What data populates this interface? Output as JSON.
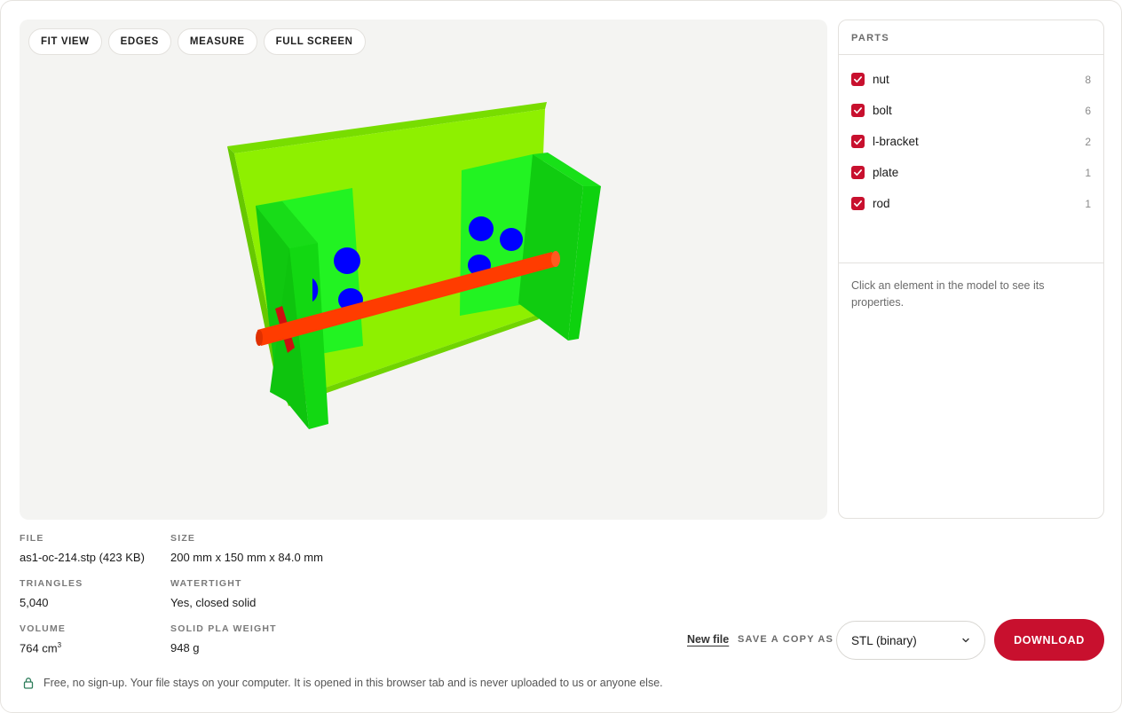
{
  "toolbar": {
    "fit_view": "FIT VIEW",
    "edges": "EDGES",
    "measure": "MEASURE",
    "full_screen": "FULL SCREEN"
  },
  "parts": {
    "title": "PARTS",
    "items": [
      {
        "name": "nut",
        "count": "8",
        "checked": true
      },
      {
        "name": "bolt",
        "count": "6",
        "checked": true
      },
      {
        "name": "l-bracket",
        "count": "2",
        "checked": true
      },
      {
        "name": "plate",
        "count": "1",
        "checked": true
      },
      {
        "name": "rod",
        "count": "1",
        "checked": true
      }
    ],
    "hint": "Click an element in the model to see its properties."
  },
  "info": {
    "file_label": "FILE",
    "file_value": "as1-oc-214.stp (423 KB)",
    "size_label": "SIZE",
    "size_value": "200 mm x 150 mm x 84.0 mm",
    "triangles_label": "TRIANGLES",
    "triangles_value": "5,040",
    "watertight_label": "WATERTIGHT",
    "watertight_value": "Yes, closed solid",
    "volume_label": "VOLUME",
    "volume_value": "764 cm",
    "volume_unit_sup": "3",
    "weight_label": "SOLID PLA WEIGHT",
    "weight_value": "948 g"
  },
  "actions": {
    "new_file": "New file",
    "save_copy_as": "SAVE A COPY AS",
    "format_selected": "STL (binary)",
    "download": "DOWNLOAD"
  },
  "footer": {
    "privacy_text": "Free, no sign-up. Your file stays on your computer. It is opened in this browser tab and is never uploaded to us or anyone else."
  },
  "icons": {
    "lock": "lock-icon",
    "chevron": "chevron-down-icon",
    "check": "check-icon"
  },
  "colors": {
    "accent": "#c8102e",
    "plate": "#8ef000",
    "bracket": "#00e81a",
    "nut": "#0000ff",
    "rod": "#ff3c00"
  }
}
